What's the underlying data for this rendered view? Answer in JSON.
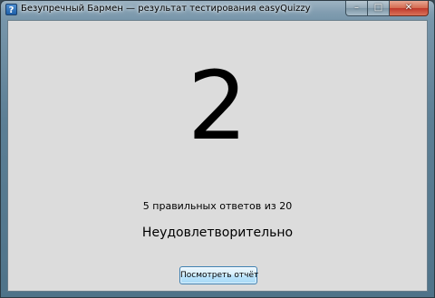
{
  "window": {
    "title": "Безупречный Бармен — результат тестирования easyQuizzy",
    "app_icon_glyph": "?",
    "caption_buttons": {
      "minimize": "–",
      "maximize": "□",
      "close": "✕"
    }
  },
  "result": {
    "grade": "2",
    "score_text": "5 правильных ответов из 20",
    "verdict": "Неудовлетворительно",
    "report_button_label": "Посмотреть отчёт"
  },
  "colors": {
    "client_background": "#dcdcdc",
    "button_border": "#3c7fb1",
    "text": "#000000"
  }
}
